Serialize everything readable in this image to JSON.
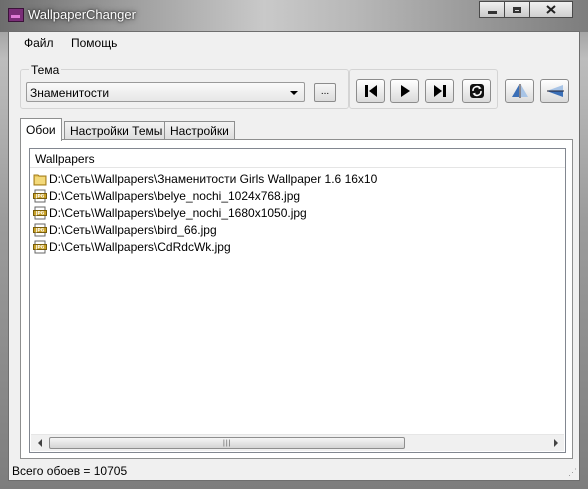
{
  "window": {
    "title": "WallpaperChanger"
  },
  "menu": {
    "file": "Файл",
    "help": "Помощь"
  },
  "theme": {
    "legend": "Тема",
    "selected": "Знаменитости",
    "browse_label": "..."
  },
  "toolbar": {
    "buttons": [
      "previous-icon",
      "play-icon",
      "next-icon",
      "refresh-icon",
      "flip-horizontal-icon",
      "flip-vertical-icon"
    ]
  },
  "tabs": [
    "Обои",
    "Настройки Темы",
    "Настройки"
  ],
  "list": {
    "header": "Wallpapers",
    "rows": [
      {
        "icon": "folder-icon",
        "text": "D:\\Сеть\\Wallpapers\\Знаменитости Girls Wallpaper 1.6 16x10"
      },
      {
        "icon": "jpg-file-icon",
        "text": "D:\\Сеть\\Wallpapers\\belye_nochi_1024x768.jpg"
      },
      {
        "icon": "jpg-file-icon",
        "text": "D:\\Сеть\\Wallpapers\\belye_nochi_1680x1050.jpg"
      },
      {
        "icon": "jpg-file-icon",
        "text": "D:\\Сеть\\Wallpapers\\bird_66.jpg"
      },
      {
        "icon": "jpg-file-icon",
        "text": "D:\\Сеть\\Wallpapers\\CdRdcWk.jpg"
      }
    ]
  },
  "status": {
    "text": "Всего обоев = 10705"
  },
  "colors": {
    "folder": "#e8c45a",
    "jpg_badge": "#c9a227"
  }
}
